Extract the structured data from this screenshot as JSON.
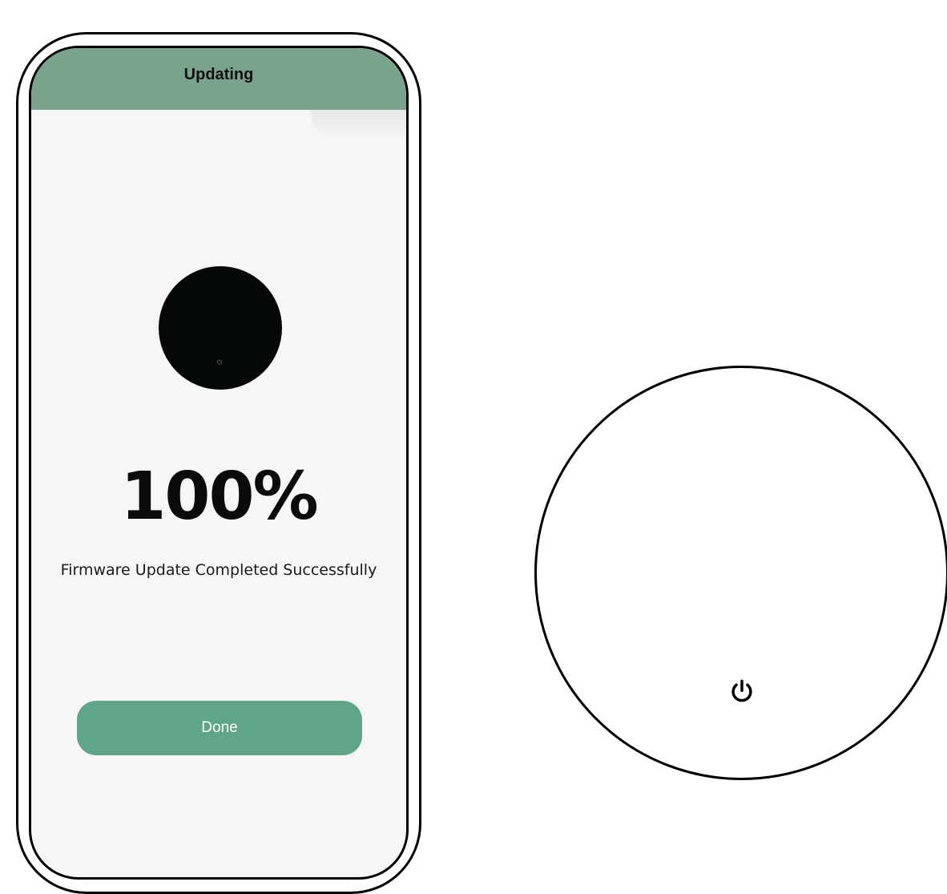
{
  "header": {
    "title": "Updating"
  },
  "progress": {
    "percent_label": "100%",
    "value": 100,
    "message": "Firmware Update Completed Successfully"
  },
  "actions": {
    "done_label": "Done"
  },
  "colors": {
    "header_bg": "#7aa38d",
    "button_bg": "#5fa588",
    "screen_bg": "#f6f6f6",
    "device_thumb": "#050808"
  },
  "icons": {
    "device_thumb_power": "power-icon",
    "device_power": "power-icon"
  }
}
